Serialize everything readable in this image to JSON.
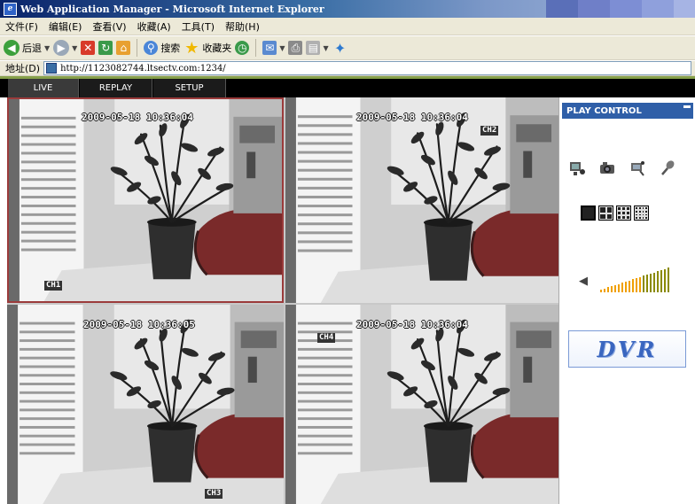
{
  "window": {
    "title": "Web Application Manager - Microsoft Internet Explorer"
  },
  "menu": {
    "items": [
      "文件(F)",
      "编辑(E)",
      "查看(V)",
      "收藏(A)",
      "工具(T)",
      "帮助(H)"
    ]
  },
  "toolbar": {
    "back_label": "后退",
    "search_label": "搜索",
    "favorites_label": "收藏夹"
  },
  "address": {
    "label": "地址(D)",
    "url": "http://1123082744.ltsectv.com:1234/"
  },
  "tabs": [
    {
      "label": "LIVE",
      "active": true
    },
    {
      "label": "REPLAY",
      "active": false
    },
    {
      "label": "SETUP",
      "active": false
    }
  ],
  "cameras": [
    {
      "timestamp": "2009-05-18 10:36:04",
      "channel": "CH1",
      "selected": true
    },
    {
      "timestamp": "2009-05-18 10:36:04",
      "channel": "CH2",
      "selected": false
    },
    {
      "timestamp": "2009-05-18 10:36:05",
      "channel": "CH3",
      "selected": false
    },
    {
      "timestamp": "2009-05-18 10:36:04",
      "channel": "CH4",
      "selected": false
    }
  ],
  "panel": {
    "header": "PLAY CONTROL",
    "control_icons": [
      "record-icon",
      "capture-icon",
      "talk-icon",
      "microphone-icon"
    ],
    "split_modes": [
      "split-1-icon",
      "split-4-icon",
      "split-9-icon",
      "split-16-icon"
    ],
    "volume_level": 1.0,
    "logo_text": "DVR"
  },
  "colors": {
    "panel_header": "#2f5fa8",
    "selected_border": "#9b3b3b",
    "volume_bar": "#f0a000",
    "logo_text": "#3a66c0"
  }
}
